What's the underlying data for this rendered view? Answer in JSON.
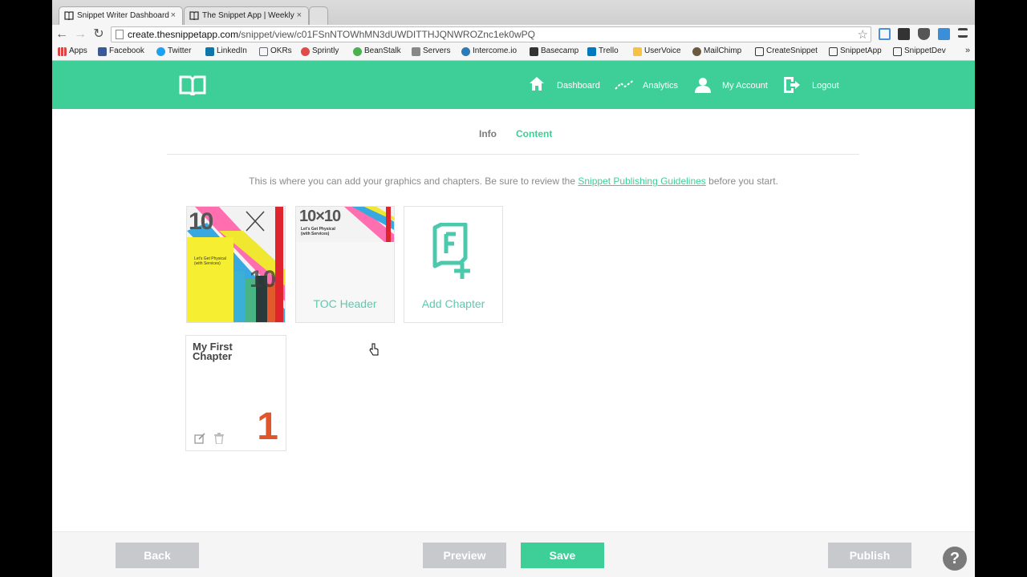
{
  "browser": {
    "tabs": [
      {
        "title": "Snippet Writer Dashboard",
        "active": true
      },
      {
        "title": "The Snippet App | Weekly",
        "active": false
      }
    ],
    "tab_close": "×",
    "url_host": "create.thesnippetapp.com",
    "url_path": "/snippet/view/c01FSnNTOWhMN3dUWDITTHJQNWROZnc1ek0wPQ",
    "bookmarks": [
      "Apps",
      "Facebook",
      "Twitter",
      "LinkedIn",
      "OKRs",
      "Sprintly",
      "BeanStalk",
      "Servers",
      "Intercome.io",
      "Basecamp",
      "Trello",
      "UserVoice",
      "MailChimp",
      "CreateSnippet",
      "SnippetApp",
      "SnippetDev"
    ],
    "bookmarks_overflow": "»"
  },
  "header": {
    "nav": [
      {
        "label": "Dashboard",
        "icon": "home-icon"
      },
      {
        "label": "Analytics",
        "icon": "chart-icon"
      },
      {
        "label": "My Account",
        "icon": "user-icon"
      },
      {
        "label": "Logout",
        "icon": "logout-icon"
      }
    ],
    "brand_color": "#3ecf98"
  },
  "subtabs": {
    "info": "Info",
    "content": "Content",
    "active": "Content"
  },
  "intro": {
    "before": "This is where you can add your graphics and chapters. Be sure to review the ",
    "link": "Snippet Publishing Guidelines",
    "after": " before you start."
  },
  "cards": {
    "cover": {
      "heading": "10",
      "subtitle_line1": "Let's Get Physical",
      "subtitle_line2": "(with Services)"
    },
    "toc": {
      "label": "TOC Header",
      "thumb_heading": "10×10",
      "thumb_sub_line1": "Let's Get Physical",
      "thumb_sub_line2": "(with Services)"
    },
    "add_chapter": {
      "label": "Add Chapter"
    },
    "chapters": [
      {
        "title": "My First Chapter",
        "number": "1"
      }
    ]
  },
  "footer": {
    "back": "Back",
    "preview": "Preview",
    "save": "Save",
    "publish": "Publish",
    "help": "?"
  }
}
